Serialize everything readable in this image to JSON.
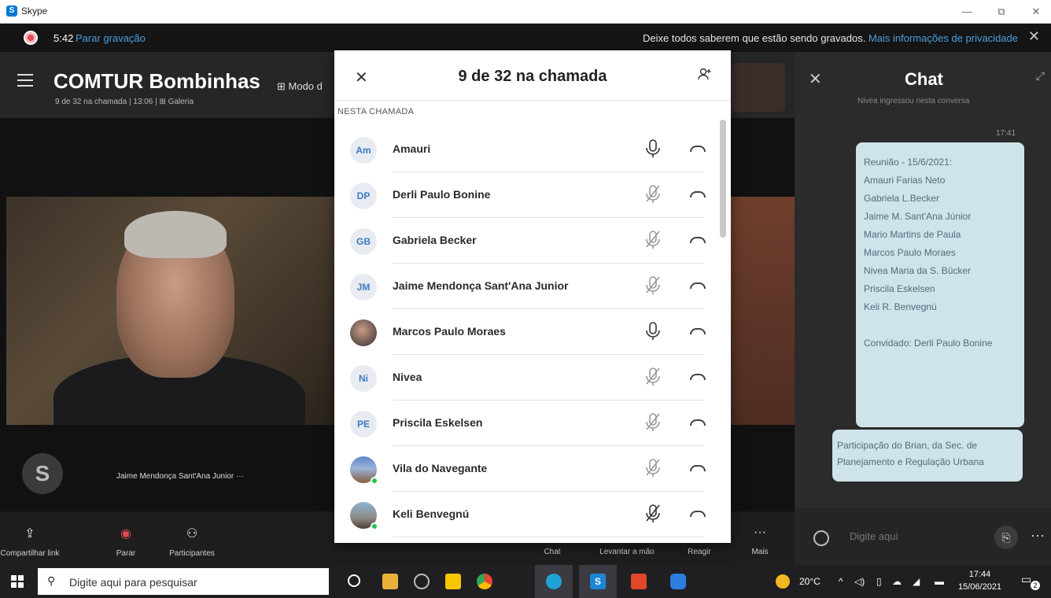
{
  "window": {
    "title": "Skype",
    "minimize": "—",
    "restore": "⧉",
    "close": "✕"
  },
  "recording": {
    "time": "5:42",
    "stop_label": "Parar gravação",
    "notice": "Deixe todos saberem que estão sendo gravados.",
    "privacy_link": "Mais informações de privacidade",
    "close": "✕"
  },
  "call": {
    "title": "COMTUR Bombinhas",
    "subtitle": "9 de 32 na chamada | 13:06 | ⊞ Galeria",
    "mode_label": "⊞ Modo d"
  },
  "video": {
    "speaker_label": "Jaime Mendonça Sant'Ana Junior ···",
    "skype_badge": "S"
  },
  "toolbar": {
    "items": [
      {
        "label": "Compartilhar link",
        "icon": "⇪"
      },
      {
        "label": "Parar",
        "icon": "◉"
      },
      {
        "label": "Participantes",
        "icon": "⚇"
      },
      {
        "label": "Chat",
        "icon": ""
      },
      {
        "label": "Levantar a mão",
        "icon": ""
      },
      {
        "label": "Reagir",
        "icon": ""
      },
      {
        "label": "Mais",
        "icon": "···"
      }
    ]
  },
  "chat": {
    "title": "Chat",
    "close": "✕",
    "expand": "⤢",
    "joined_text": "Nivea ingressou nesta conversa",
    "timestamp": "17:41",
    "message1_lines": [
      "Reunião - 15/6/2021:",
      "Amauri Farias Neto",
      "Gabriela L.Becker",
      "Jaime M. Sant'Ana Júnior",
      "Mario Martins de Paula",
      "Marcos Paulo Moraes",
      "Nivea Maria da S. Bücker",
      "Priscila Eskelsen",
      "Keli R. Benvegnú",
      "",
      "Convidado: Derli Paulo Bonine"
    ],
    "message2": "Participação do Brian, da Sec. de Planejamento e Regulação Urbana",
    "input_placeholder": "Digite aqui",
    "more": "···"
  },
  "modal": {
    "title": "9 de 32 na chamada",
    "close": "✕",
    "section": "NESTA CHAMADA",
    "participants": [
      {
        "initials": "Am",
        "name": "Amauri",
        "mic": "on",
        "avatar": "initials"
      },
      {
        "initials": "DP",
        "name": "Derli Paulo Bonine",
        "mic": "muted",
        "avatar": "initials"
      },
      {
        "initials": "GB",
        "name": "Gabriela Becker",
        "mic": "muted",
        "avatar": "initials"
      },
      {
        "initials": "JM",
        "name": "Jaime Mendonça Sant'Ana Junior",
        "mic": "muted",
        "avatar": "initials"
      },
      {
        "initials": "",
        "name": "Marcos Paulo Moraes",
        "mic": "on",
        "avatar": "photo"
      },
      {
        "initials": "Ni",
        "name": "Nivea",
        "mic": "muted",
        "avatar": "initials"
      },
      {
        "initials": "PE",
        "name": "Priscila Eskelsen",
        "mic": "muted",
        "avatar": "initials"
      },
      {
        "initials": "",
        "name": "Vila do Navegante",
        "mic": "muted",
        "avatar": "photo2",
        "online": true
      },
      {
        "initials": "",
        "name": "Keli Benvegnú",
        "mic": "muted-dark",
        "avatar": "photo3",
        "online": true
      }
    ]
  },
  "taskbar": {
    "search_placeholder": "Digite aqui para pesquisar",
    "weather": "20°C",
    "time": "17:44",
    "date": "15/06/2021",
    "notifications": "2"
  },
  "colors": {
    "accent": "#4a9ee0",
    "record": "#e34b52",
    "bubble": "#cfe3ea",
    "initials": "#3b7bbf"
  }
}
